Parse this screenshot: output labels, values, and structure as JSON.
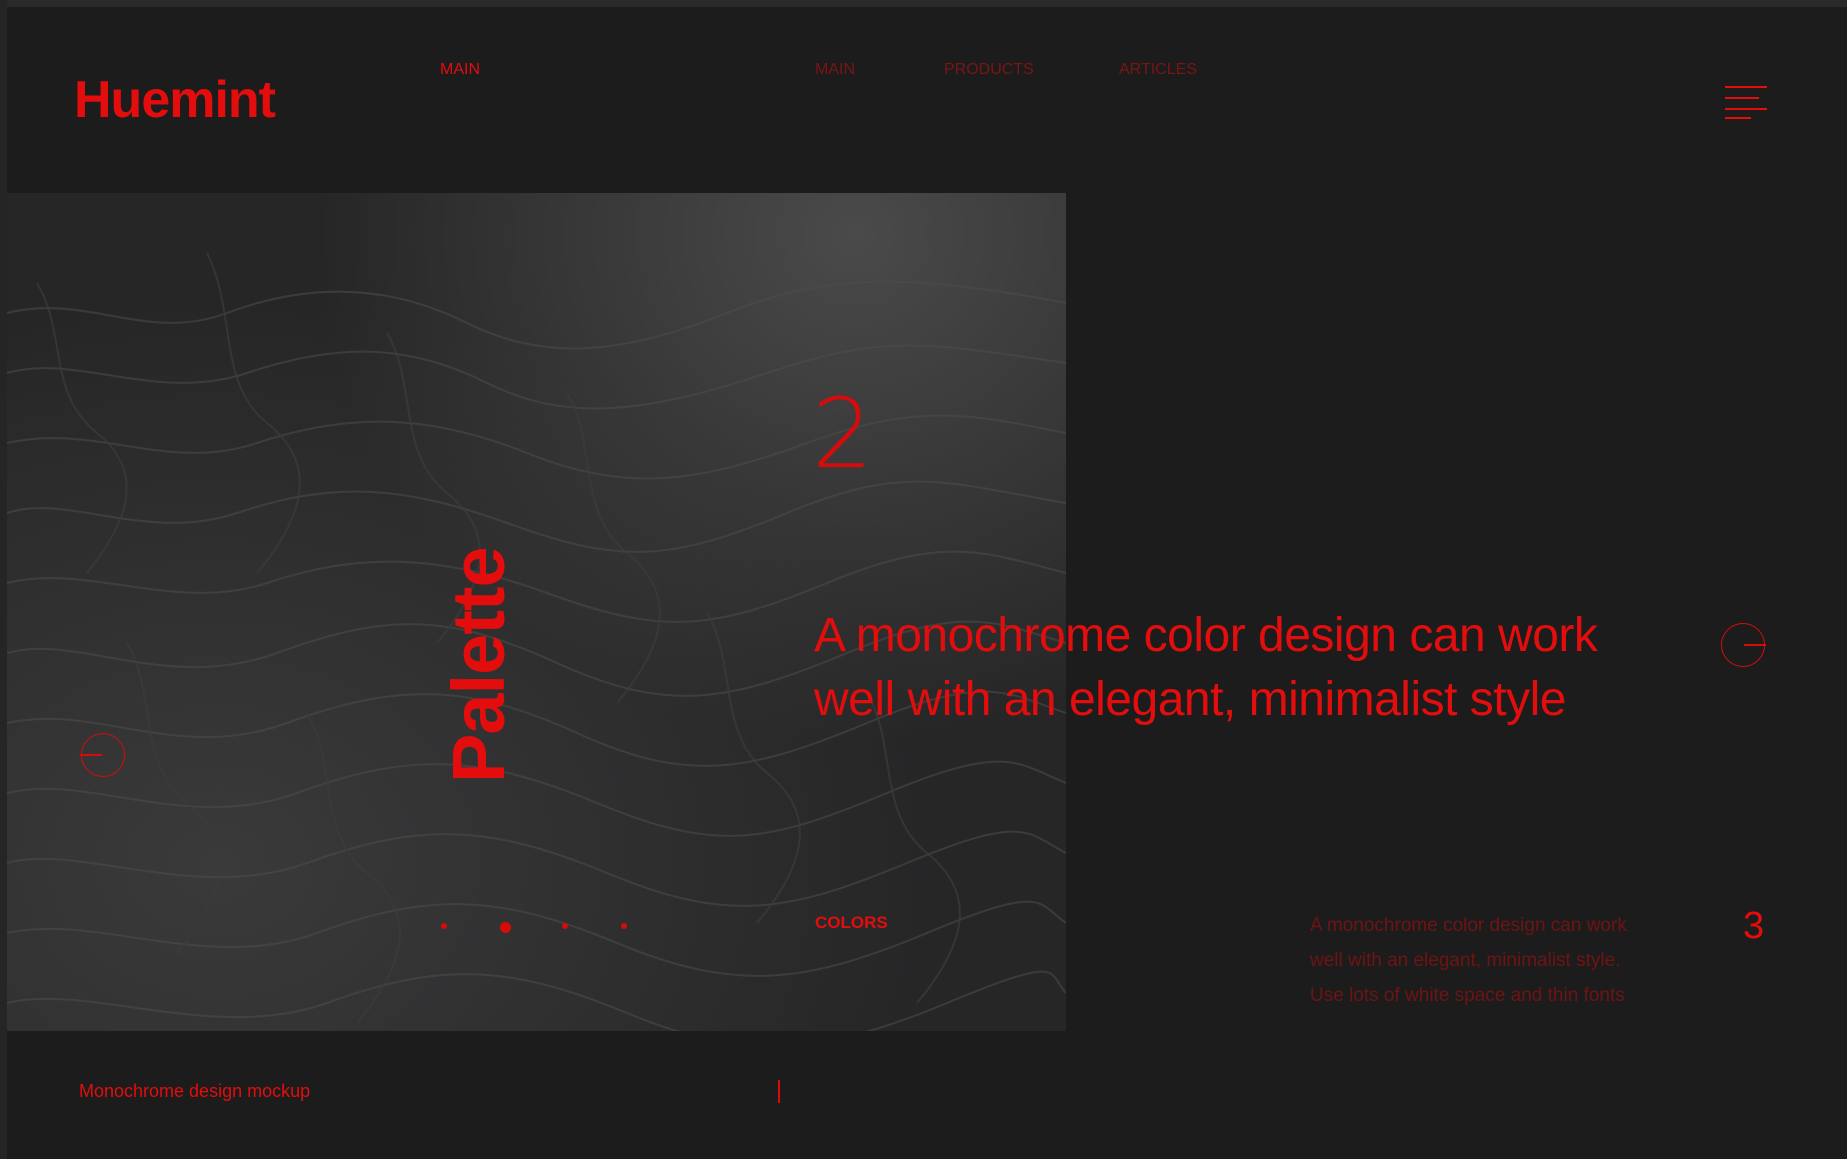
{
  "brand": {
    "logo": "Huemint",
    "accent_color": "#e30d0d",
    "background_color": "#1c1c1d"
  },
  "header": {
    "active_label": "MAIN",
    "nav": [
      "MAIN",
      "PRODUCTS",
      "ARTICLES"
    ],
    "menu_icon": "hamburger-icon"
  },
  "hero": {
    "vertical_title": "Palette",
    "slide_number": "2",
    "headline": "A monochrome color design can work well with an elegant, minimalist style",
    "section_label": "COLORS",
    "description": "A monochrome color design can work well with an elegant, minimalist style. Use lots of white space and thin fonts",
    "next_number": "3",
    "prev_icon": "arrow-left-circle-icon",
    "next_icon": "arrow-right-circle-icon",
    "image": "dark-water-ripples-photo"
  },
  "pagination": {
    "count": 4,
    "active_index": 1
  },
  "footer": {
    "caption": "Monochrome design mockup"
  }
}
